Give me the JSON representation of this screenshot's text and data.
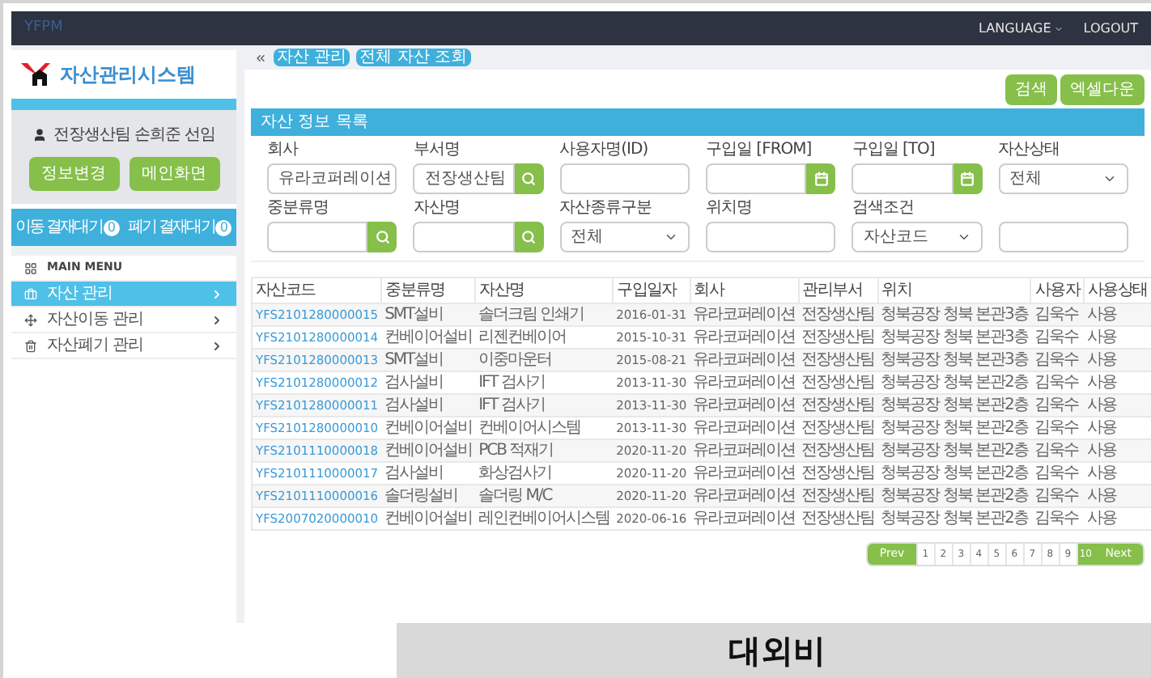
{
  "navbar": {
    "brand": "YFPM",
    "links": [
      {
        "label": "LANGUAGE",
        "dropdown": true
      },
      {
        "label": "LOGOUT",
        "dropdown": false
      }
    ]
  },
  "sidebar": {
    "title": "자산관리시스템",
    "user": "전장생산팀 손희준 선임",
    "buttons": [
      "정보변경",
      "메인화면"
    ],
    "approvals": [
      {
        "label": "이동 결재대기",
        "count": "0"
      },
      {
        "label": "폐기 결재대기",
        "count": "0"
      }
    ],
    "menu_header": "MAIN MENU",
    "items": [
      {
        "label": "자산 관리",
        "kind": "briefcase",
        "selected": true
      },
      {
        "label": "자산이동 관리",
        "kind": "move",
        "selected": false
      },
      {
        "label": "자산폐기 관리",
        "kind": "trash",
        "selected": false
      }
    ]
  },
  "breadcrumb": [
    "자산 관리",
    "전체 자산 조회"
  ],
  "actions": [
    "검색",
    "엑셀다운"
  ],
  "panel_title": "자산 정보 목록",
  "filters": [
    {
      "label": "회사",
      "kind": "select",
      "value": "유라코퍼레이션"
    },
    {
      "label": "부서명",
      "kind": "search",
      "value": "전장생산팀"
    },
    {
      "label": "사용자명(ID)",
      "kind": "text"
    },
    {
      "label": "구입일 [FROM]",
      "kind": "date"
    },
    {
      "label": "구입일 [TO]",
      "kind": "date"
    },
    {
      "label": "자산상태",
      "kind": "select",
      "value": "전체"
    },
    {
      "label": "중분류명",
      "kind": "search"
    },
    {
      "label": "자산명",
      "kind": "search"
    },
    {
      "label": "자산종류구분",
      "kind": "select",
      "value": "전체"
    },
    {
      "label": "위치명",
      "kind": "text"
    },
    {
      "label": "검색조건",
      "kind": "select",
      "value": "자산코드"
    },
    {
      "kind": "text"
    }
  ],
  "table": {
    "columns": [
      "자산코드",
      "중분류명",
      "자산명",
      "구입일자",
      "회사",
      "관리부서",
      "위치",
      "사용자",
      "사용상태"
    ],
    "rows": [
      [
        "YFS2101280000015",
        "SMT설비",
        "솔더크림 인쇄기",
        "2016-01-31",
        "유라코퍼레이션",
        "전장생산팀",
        "청북공장 청북 본관3층",
        "김욱수",
        "사용"
      ],
      [
        "YFS2101280000014",
        "컨베이어설비",
        "리젠컨베이어",
        "2015-10-31",
        "유라코퍼레이션",
        "전장생산팀",
        "청북공장 청북 본관3층",
        "김욱수",
        "사용"
      ],
      [
        "YFS2101280000013",
        "SMT설비",
        "이중마운터",
        "2015-08-21",
        "유라코퍼레이션",
        "전장생산팀",
        "청북공장 청북 본관3층",
        "김욱수",
        "사용"
      ],
      [
        "YFS2101280000012",
        "검사설비",
        "IFT 검사기",
        "2013-11-30",
        "유라코퍼레이션",
        "전장생산팀",
        "청북공장 청북 본관2층",
        "김욱수",
        "사용"
      ],
      [
        "YFS2101280000011",
        "검사설비",
        "IFT 검사기",
        "2013-11-30",
        "유라코퍼레이션",
        "전장생산팀",
        "청북공장 청북 본관2층",
        "김욱수",
        "사용"
      ],
      [
        "YFS2101280000010",
        "컨베이어설비",
        "컨베이어시스템",
        "2013-11-30",
        "유라코퍼레이션",
        "전장생산팀",
        "청북공장 청북 본관2층",
        "김욱수",
        "사용"
      ],
      [
        "YFS2101110000018",
        "컨베이어설비",
        "PCB 적재기",
        "2020-11-20",
        "유라코퍼레이션",
        "전장생산팀",
        "청북공장 청북 본관2층",
        "김욱수",
        "사용"
      ],
      [
        "YFS2101110000017",
        "검사설비",
        "화상검사기",
        "2020-11-20",
        "유라코퍼레이션",
        "전장생산팀",
        "청북공장 청북 본관2층",
        "김욱수",
        "사용"
      ],
      [
        "YFS2101110000016",
        "솔더링설비",
        "솔더링 M/C",
        "2020-11-20",
        "유라코퍼레이션",
        "전장생산팀",
        "청북공장 청북 본관2층",
        "김욱수",
        "사용"
      ],
      [
        "YFS2007020000010",
        "컨베이어설비",
        "레인컨베이어시스템",
        "2020-06-16",
        "유라코퍼레이션",
        "전장생산팀",
        "청북공장 청북 본관2층",
        "김욱수",
        "사용"
      ]
    ]
  },
  "pagination": {
    "prev": "Prev",
    "next": "Next",
    "pages": [
      {
        "label": "1",
        "selected": false
      },
      {
        "label": "2",
        "selected": false
      },
      {
        "label": "3",
        "selected": false
      },
      {
        "label": "4",
        "selected": false
      },
      {
        "label": "5",
        "selected": false
      },
      {
        "label": "6",
        "selected": false
      },
      {
        "label": "7",
        "selected": false
      },
      {
        "label": "8",
        "selected": false
      },
      {
        "label": "9",
        "selected": false
      },
      {
        "label": "10",
        "selected": true
      }
    ]
  },
  "stamp": "대외비"
}
